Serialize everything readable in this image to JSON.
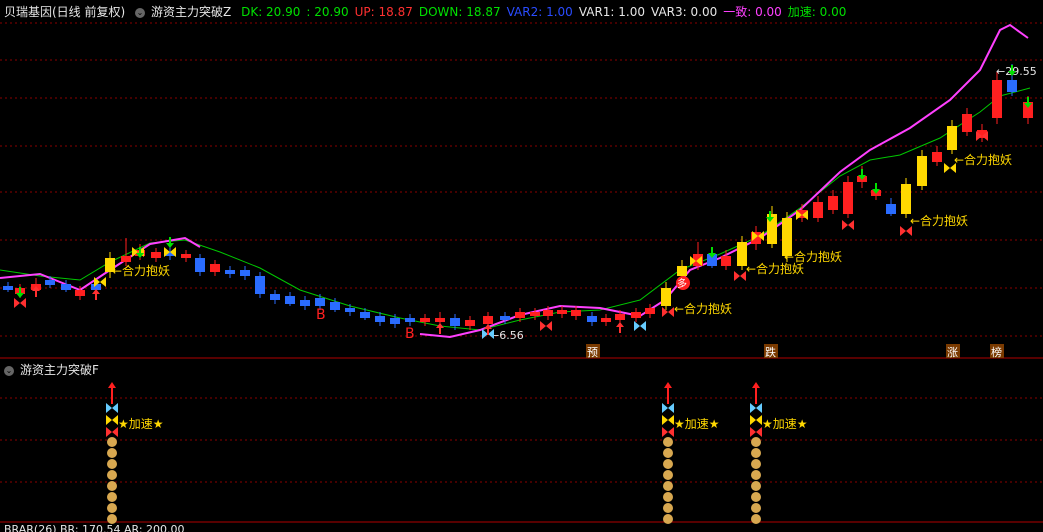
{
  "header": {
    "stock": "贝瑞基因(日线 前复权)",
    "indicator": "游资主力突破Z",
    "values": [
      {
        "label": "DK: 20.90",
        "color": "#00e000"
      },
      {
        "label": ": 20.90",
        "color": "#00e000"
      },
      {
        "label": "UP: 18.87",
        "color": "#ff3030"
      },
      {
        "label": "DOWN: 18.87",
        "color": "#00e000"
      },
      {
        "label": "VAR2: 1.00",
        "color": "#2a4cff"
      },
      {
        "label": "VAR1: 1.00",
        "color": "#e6e6e6"
      },
      {
        "label": "VAR3: 0.00",
        "color": "#e6e6e6"
      },
      {
        "label": "一致: 0.00",
        "color": "#ff40ff"
      },
      {
        "label": "加速: 0.00",
        "color": "#00e000"
      }
    ]
  },
  "lower_panel": {
    "title": "游资主力突破F"
  },
  "bottom_panel": {
    "label": "BRAR(26)  BR: 170.54  AR: 200.00"
  },
  "annotations": {
    "heli": "←合力抱妖",
    "jiasu": "★加速★",
    "buy": "B",
    "duo": "多",
    "low_price": "6.56",
    "high_price": "29.55",
    "tags": [
      "预",
      "跌",
      "涨",
      "榜"
    ]
  },
  "colors": {
    "up": "#ff2020",
    "down": "#2a4cff",
    "yellow": "#ffd800",
    "green_line": "#00c800",
    "magenta_line": "#ff40ff",
    "grid": "#8a0000"
  }
}
